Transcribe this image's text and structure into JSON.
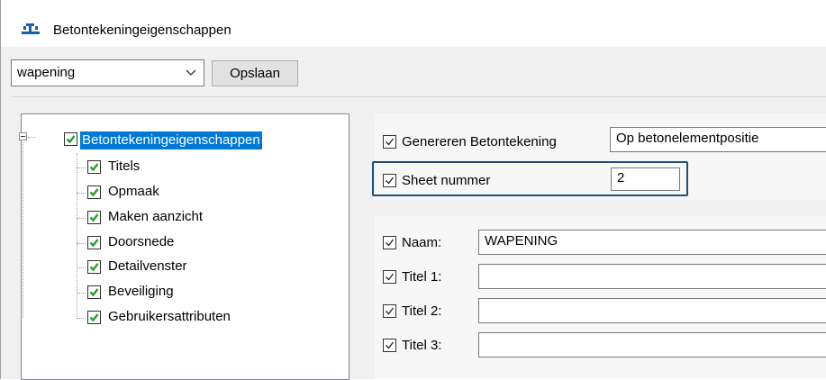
{
  "window": {
    "title": "Betontekeningeigenschappen",
    "icon": "drawing-app-icon",
    "accent": "#0078d7",
    "highlight_color": "#1f4e79"
  },
  "toolbar": {
    "preset_value": "wapening",
    "save_label": "Opslaan"
  },
  "tree": {
    "root": {
      "label": "Betontekeningeigenschappen",
      "checked": true,
      "selected": true
    },
    "items": [
      {
        "label": "Titels",
        "checked": true
      },
      {
        "label": "Opmaak",
        "checked": true
      },
      {
        "label": "Maken aanzicht",
        "checked": true
      },
      {
        "label": "Doorsnede",
        "checked": true
      },
      {
        "label": "Detailvenster",
        "checked": true
      },
      {
        "label": "Beveiliging",
        "checked": true
      },
      {
        "label": "Gebruikersattributen",
        "checked": true
      }
    ]
  },
  "settings": {
    "generate": {
      "label": "Genereren Betontekening",
      "checked": true,
      "value": "Op betonelementpositie"
    },
    "sheet": {
      "label": "Sheet nummer",
      "checked": true,
      "value": "2"
    }
  },
  "titles": {
    "name": {
      "label": "Naam:",
      "checked": true,
      "value": "WAPENING"
    },
    "title1": {
      "label": "Titel 1:",
      "checked": true,
      "value": ""
    },
    "title2": {
      "label": "Titel 2:",
      "checked": true,
      "value": ""
    },
    "title3": {
      "label": "Titel 3:",
      "checked": true,
      "value": ""
    }
  }
}
